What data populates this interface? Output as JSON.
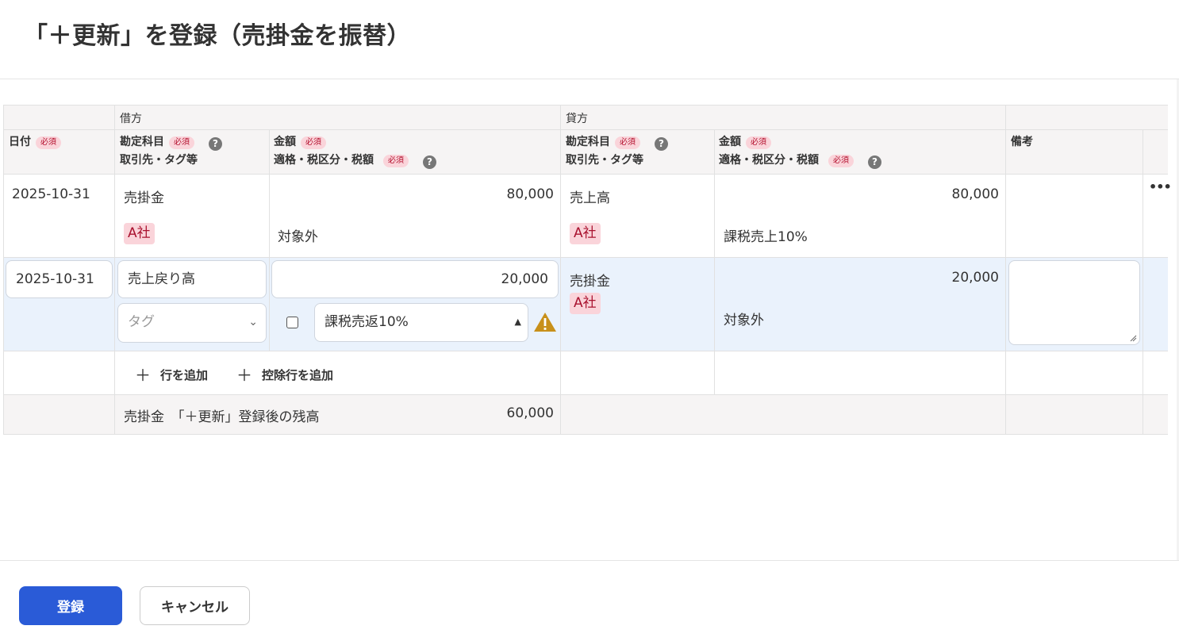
{
  "page_title": "「＋更新」を登録（売掛金を振替）",
  "required_badge": "必須",
  "help_glyph": "?",
  "headers": {
    "debit_group": "借方",
    "credit_group": "貸方",
    "date": "日付",
    "account": "勘定科目",
    "partner_tag": "取引先・タグ等",
    "amount": "金額",
    "tax_info": "適格・税区分・税額",
    "memo": "備考"
  },
  "row1": {
    "date": "2025-10-31",
    "debit_account": "売掛金",
    "debit_tag": "A社",
    "debit_amount": "80,000",
    "debit_tax": "対象外",
    "credit_account": "売上高",
    "credit_tag": "A社",
    "credit_amount": "80,000",
    "credit_tax": "課税売上10%",
    "more_glyph": "•••"
  },
  "row2": {
    "date": "2025-10-31",
    "debit_account": "売上戻り高",
    "tag_placeholder": "タグ",
    "debit_amount": "20,000",
    "tax_select": "課税売返10%",
    "credit_account": "売掛金",
    "credit_tag": "A社",
    "credit_amount": "20,000",
    "credit_tax": "対象外",
    "memo": ""
  },
  "actions": {
    "plus_glyph": "＋",
    "add_row": "行を追加",
    "add_deduction_row": "控除行を追加"
  },
  "balance": {
    "label": "売掛金　「＋更新」登録後の残高",
    "value": "60,000"
  },
  "footer": {
    "register": "登録",
    "cancel": "キャンセル"
  },
  "colors": {
    "primary": "#2a5bd7",
    "required_bg": "#fad4da",
    "required_text": "#b3102e",
    "highlight_row": "#eaf2fc",
    "warning": "#c8901a"
  }
}
